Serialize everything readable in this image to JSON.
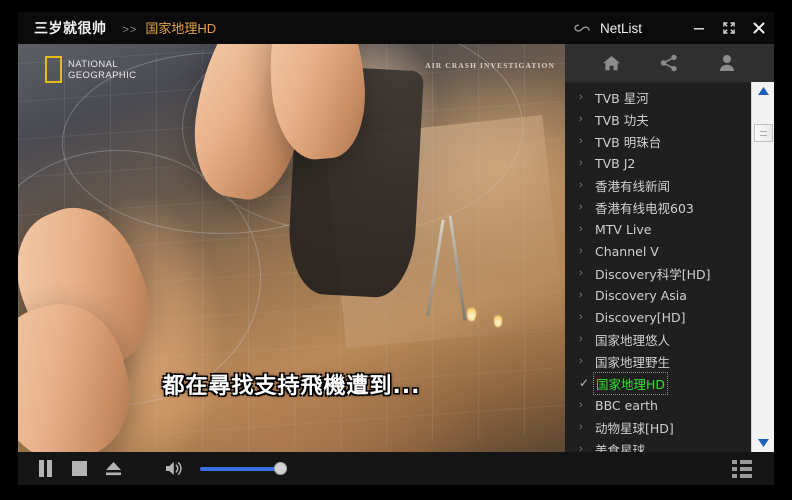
{
  "titlebar": {
    "app_name": "三岁就很帅",
    "separator": ">>",
    "channel": "国家地理HD",
    "window_title": "NetList",
    "cloud_icon": "infinity-cloud-icon",
    "minimize_label": "−",
    "maximize_label": "⛶",
    "close_label": "✕"
  },
  "video": {
    "logo_line1": "NATIONAL",
    "logo_line2": "GEOGRAPHIC",
    "watermark": "AIR CRASH INVESTIGATION",
    "subtitle": "都在尋找支持飛機遭到..."
  },
  "panel": {
    "toolbar": [
      {
        "name": "home-icon",
        "label": "Home"
      },
      {
        "name": "share-icon",
        "label": "Share"
      },
      {
        "name": "user-icon",
        "label": "Account"
      }
    ],
    "channels": [
      {
        "label": "TVB 星河",
        "selected": false
      },
      {
        "label": "TVB 功夫",
        "selected": false
      },
      {
        "label": "TVB 明珠台",
        "selected": false
      },
      {
        "label": "TVB J2",
        "selected": false
      },
      {
        "label": "香港有线新闻",
        "selected": false
      },
      {
        "label": "香港有线电视603",
        "selected": false
      },
      {
        "label": "MTV Live",
        "selected": false
      },
      {
        "label": "Channel V",
        "selected": false
      },
      {
        "label": "Discovery科学[HD]",
        "selected": false
      },
      {
        "label": "Discovery Asia",
        "selected": false
      },
      {
        "label": "Discovery[HD]",
        "selected": false
      },
      {
        "label": "国家地理悠人",
        "selected": false
      },
      {
        "label": "国家地理野生",
        "selected": false
      },
      {
        "label": "国家地理HD",
        "selected": true
      },
      {
        "label": "BBC earth",
        "selected": false
      },
      {
        "label": "动物星球[HD]",
        "selected": false
      },
      {
        "label": "美食星球",
        "selected": false
      }
    ],
    "collapsed_marker": "›",
    "selected_marker": "✓",
    "scrollbar": {
      "up": "▲",
      "down": "▼"
    }
  },
  "controls": {
    "pause_label": "Pause",
    "stop_label": "Stop",
    "eject_label": "Eject",
    "volume_label": "Volume",
    "volume_value": 90,
    "view_toggle_label": "List view"
  },
  "colors": {
    "accent_orange": "#e2a24a",
    "selected_green": "#2ee02e",
    "slider_blue": "#3b6fe0",
    "panel_bg": "#1f1f1f",
    "toolbar_bg": "#303030"
  }
}
